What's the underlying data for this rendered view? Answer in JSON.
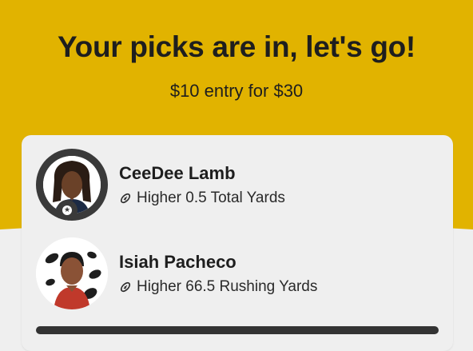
{
  "header": {
    "title": "Your picks are in, let's go!",
    "subtitle": "$10 entry for $30",
    "background_color": "#e1b300"
  },
  "picks": [
    {
      "player": "CeeDee Lamb",
      "pick_text": "Higher 0.5 Total Yards",
      "avatar_style": "ringed-with-badge"
    },
    {
      "player": "Isiah Pacheco",
      "pick_text": "Higher 66.5 Rushing Yards",
      "avatar_style": "plain"
    }
  ],
  "icons": {
    "pick_icon": "football-icon",
    "badge_icon": "star-icon"
  }
}
